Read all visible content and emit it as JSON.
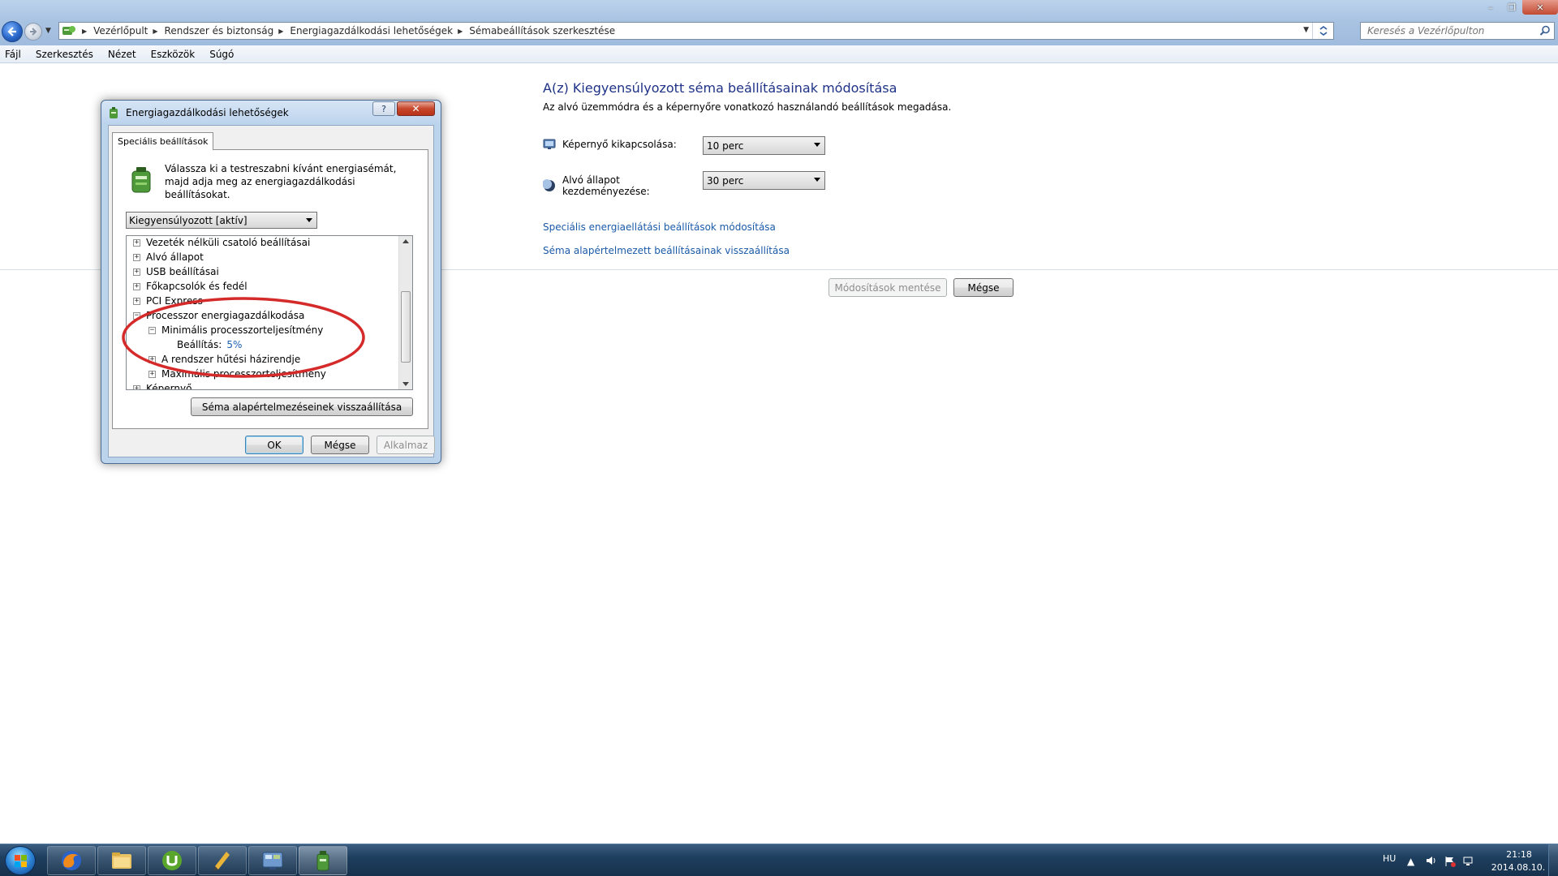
{
  "window": {
    "minimize": "–",
    "maximize": "❐",
    "close": "✕"
  },
  "address_bar": {
    "crumbs": [
      "Vezérlőpult",
      "Rendszer és biztonság",
      "Energiagazdálkodási lehetőségek",
      "Sémabeállítások szerkesztése"
    ]
  },
  "search": {
    "placeholder": "Keresés a Vezérlőpulton"
  },
  "menu": [
    "Fájl",
    "Szerkesztés",
    "Nézet",
    "Eszközök",
    "Súgó"
  ],
  "main": {
    "title": "A(z) Kiegyensúlyozott séma beállításainak módosítása",
    "description": "Az alvó üzemmódra és a képernyőre vonatkozó használandó beállítások megadása.",
    "display_off_label": "Képernyő kikapcsolása:",
    "display_off_value": "10 perc",
    "sleep_label": "Alvó állapot kezdeményezése:",
    "sleep_value": "30 perc",
    "link_advanced": "Speciális energiaellátási beállítások módosítása",
    "link_restore": "Séma alapértelmezett beállításainak visszaállítása",
    "save_button": "Módosítások mentése",
    "cancel_button": "Mégse"
  },
  "dialog": {
    "title": "Energiagazdálkodási lehetőségek",
    "help_button": "?",
    "close_button": "✕",
    "tab": "Speciális beállítások",
    "instruction": "Válassza ki a testreszabni kívánt energiasémát, majd adja meg az energiagazdálkodási beállításokat.",
    "plan_select": "Kiegyensúlyozott [aktív]",
    "tree": [
      {
        "label": "Vezeték nélküli csatoló beállításai",
        "expander": "+"
      },
      {
        "label": "Alvó állapot",
        "expander": "+"
      },
      {
        "label": "USB beállításai",
        "expander": "+"
      },
      {
        "label": "Főkapcsolók és fedél",
        "expander": "+"
      },
      {
        "label": "PCI Express",
        "expander": "+"
      },
      {
        "label": "Processzor energiagazdálkodása",
        "expander": "−"
      },
      {
        "label": "Minimális processzorteljesítmény",
        "expander": "−"
      },
      {
        "label": "Beállítás:",
        "value": "5%"
      },
      {
        "label": "A rendszer hűtési házirendje",
        "expander": "+"
      },
      {
        "label": "Maximális processzorteljesítmény",
        "expander": "+"
      },
      {
        "label": "Képernyő",
        "expander": "+"
      }
    ],
    "restore_button": "Séma alapértelmezéseinek visszaállítása",
    "ok_button": "OK",
    "cancel_button": "Mégse",
    "apply_button": "Alkalmaz"
  },
  "annotation": {
    "color": "#d42a2a"
  },
  "taskbar": {
    "language": "HU",
    "time": "21:18",
    "date": "2014.08.10."
  }
}
